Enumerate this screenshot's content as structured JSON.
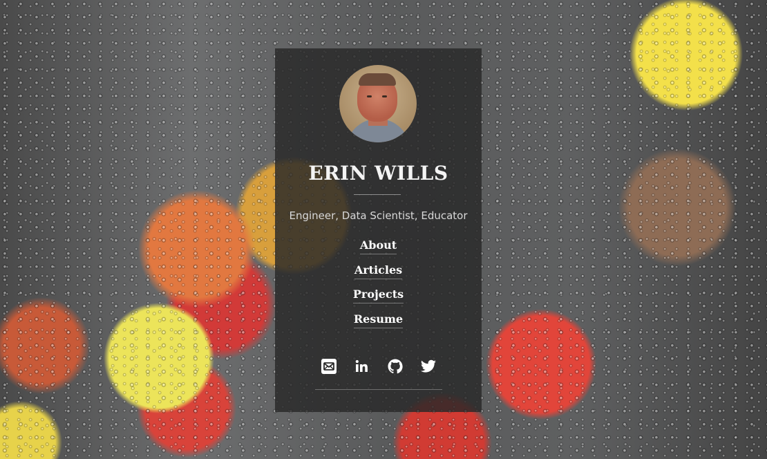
{
  "profile": {
    "name": "ERIN WILLS",
    "tagline": "Engineer, Data Scientist, Educator",
    "avatar_alt": "profile photo"
  },
  "nav": {
    "items": [
      {
        "label": "About"
      },
      {
        "label": "Articles"
      },
      {
        "label": "Projects"
      },
      {
        "label": "Resume"
      }
    ]
  },
  "social": {
    "icons": [
      "email-icon",
      "linkedin-icon",
      "github-icon",
      "twitter-icon"
    ],
    "icon_color": "#ffffff"
  },
  "colors": {
    "card_background": "#282828",
    "text": "#f4f4f4",
    "subtitle": "#d8d8d8"
  }
}
